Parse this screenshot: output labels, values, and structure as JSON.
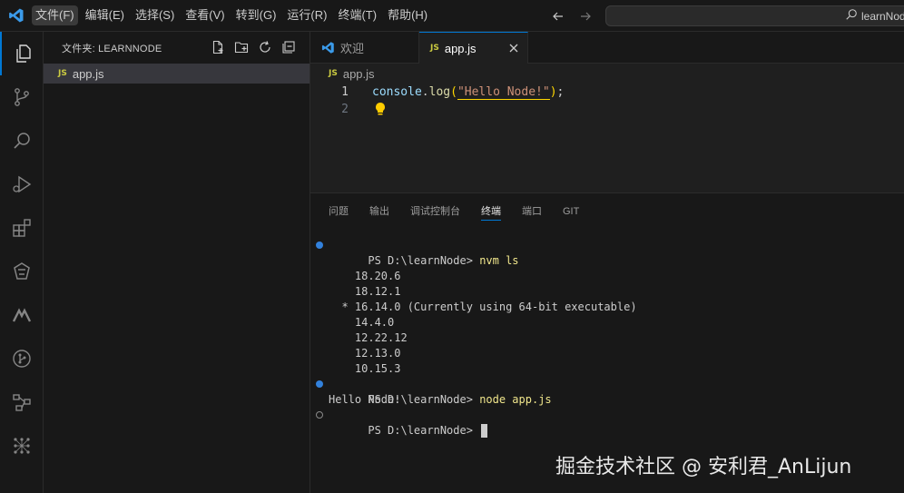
{
  "titlebar": {
    "menu": [
      "文件(F)",
      "编辑(E)",
      "选择(S)",
      "查看(V)",
      "转到(G)",
      "运行(R)",
      "终端(T)",
      "帮助(H)"
    ],
    "search_text": "learnNod"
  },
  "sidebar": {
    "title": "文件夹: LEARNNODE",
    "files": [
      {
        "badge": "JS",
        "name": "app.js"
      }
    ]
  },
  "tabs": [
    {
      "label": "欢迎"
    },
    {
      "badge": "JS",
      "label": "app.js"
    }
  ],
  "breadcrumb": {
    "badge": "JS",
    "file": "app.js"
  },
  "editor": {
    "line_numbers": [
      "1",
      "2"
    ],
    "code": {
      "obj": "console",
      "dot": ".",
      "fn": "log",
      "open": "(",
      "str": "\"Hello Node!\"",
      "close": ")",
      "semi": ";"
    }
  },
  "panel": {
    "tabs": [
      "问题",
      "输出",
      "调试控制台",
      "终端",
      "端口",
      "GIT"
    ],
    "active_tab": "终端"
  },
  "terminal": {
    "prompt1": "PS D:\\learnNode> ",
    "cmd1": "nvm ls",
    "versions": [
      "    18.20.6",
      "    18.12.1",
      "  * 16.14.0 (Currently using 64-bit executable)",
      "    14.4.0",
      "    12.22.12",
      "    12.13.0",
      "    10.15.3"
    ],
    "prompt2": "PS D:\\learnNode> ",
    "cmd2": "node app.js",
    "output": "Hello Node!",
    "prompt3": "PS D:\\learnNode> "
  },
  "watermark": "掘金技术社区 @ 安利君_AnLijun",
  "colors": {
    "accent": "#0078d4",
    "js_badge": "#cbcb41",
    "string": "#ce9178"
  }
}
